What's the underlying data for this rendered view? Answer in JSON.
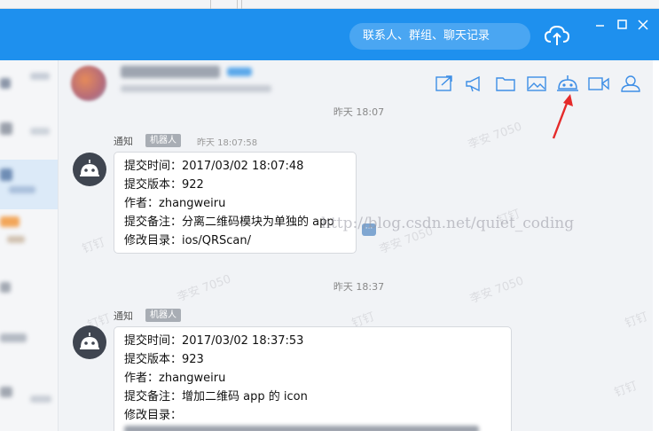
{
  "titlebar": {
    "search_placeholder": "联系人、群组、聊天记录",
    "accent": "#1e90ee"
  },
  "toolbar": {
    "icons": [
      "share-icon",
      "announcement-icon",
      "folder-icon",
      "image-icon",
      "robot-icon",
      "video-icon",
      "members-icon"
    ]
  },
  "messages": [
    {
      "time": "昨天 18:07",
      "sender": "通知",
      "tag": "机器人",
      "sender_time": "昨天 18:07:58",
      "lines": [
        "提交时间：2017/03/02 18:07:48",
        "提交版本：922",
        "作者：zhangweiru",
        "提交备注：分离二维码模块为单独的 app",
        "修改目录：ios/QRScan/"
      ]
    },
    {
      "time": "昨天 18:37",
      "sender": "通知",
      "tag": "机器人",
      "lines": [
        "提交时间：2017/03/02 18:37:53",
        "提交版本：923",
        "作者：zhangweiru",
        "提交备注：增加二维码 app 的 icon",
        "修改目录："
      ]
    }
  ],
  "watermarks": {
    "name": "李安 7050",
    "brand": "钉钉",
    "url": "http://blog.csdn.net/quiet_coding"
  },
  "more_glyph": "···"
}
